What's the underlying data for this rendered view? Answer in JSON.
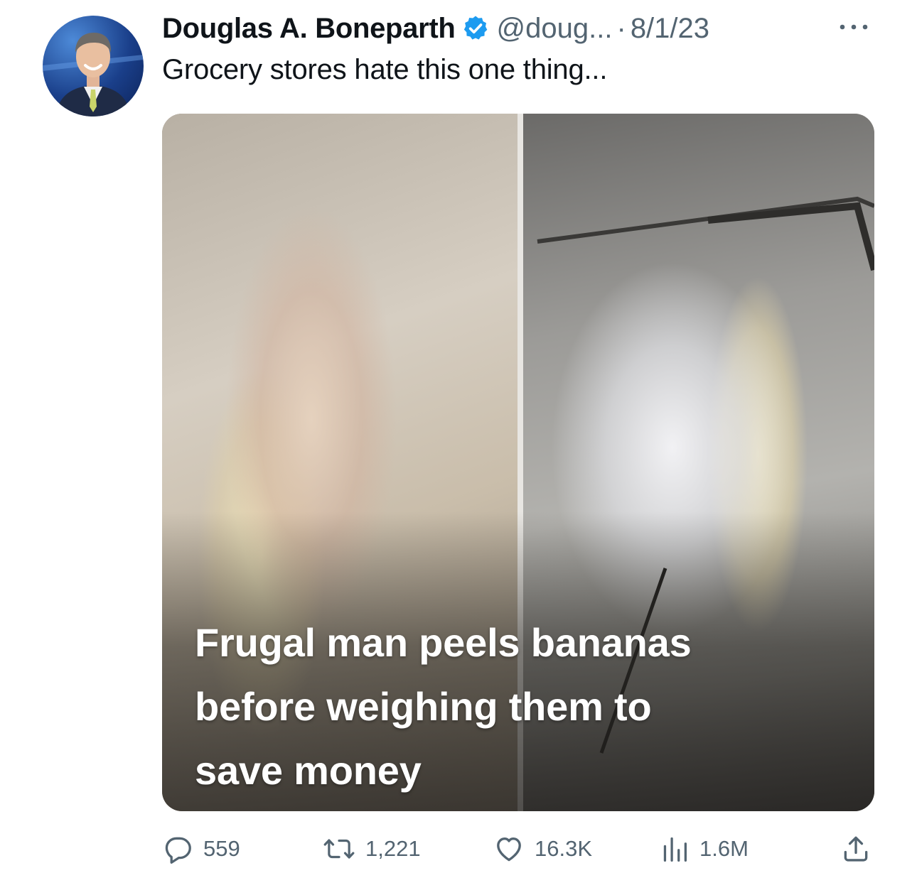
{
  "author": {
    "name": "Douglas A. Boneparth",
    "handle": "@doug...",
    "date": "8/1/23",
    "verified": true,
    "verified_color": "#1d9bf0"
  },
  "tweet": {
    "text": "Grocery stores hate this one thing..."
  },
  "media": {
    "caption_lines": [
      "Frugal man peels bananas",
      "before weighing them to",
      "save money"
    ]
  },
  "actions": {
    "replies": "559",
    "retweets": "1,221",
    "likes": "16.3K",
    "views": "1.6M"
  },
  "icons": {
    "avatar": "avatar",
    "verified": "verified-badge-icon",
    "more": "more-options-icon",
    "reply": "reply-icon",
    "retweet": "retweet-icon",
    "like": "heart-icon",
    "views": "views-chart-icon",
    "share": "share-icon"
  },
  "colors": {
    "text": "#0f1419",
    "secondary": "#536471",
    "accent": "#1d9bf0"
  }
}
